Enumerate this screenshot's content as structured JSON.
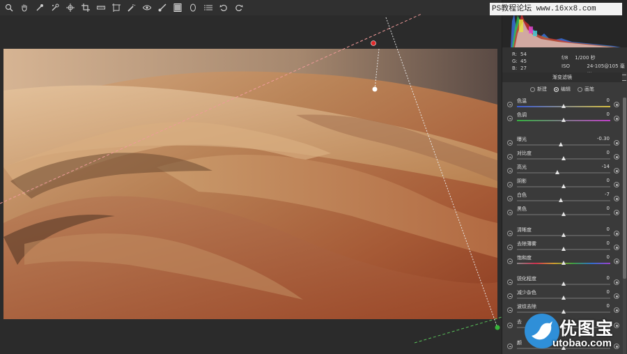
{
  "toolbar": {
    "tools": [
      "zoom-icon",
      "hand-icon",
      "white-balance-icon",
      "color-sampler-icon",
      "target-adjust-icon",
      "crop-icon",
      "straighten-icon",
      "transform-icon",
      "spot-removal-icon",
      "red-eye-icon",
      "adjustment-brush-icon",
      "graduated-filter-icon",
      "radial-filter-icon",
      "presets-list-icon",
      "rotate-left-icon",
      "rotate-right-icon"
    ]
  },
  "watermark_top": "PS教程论坛 www.16xx8.com",
  "info": {
    "r_label": "R:",
    "r": "54",
    "g_label": "G:",
    "g": "45",
    "b_label": "B:",
    "b": "27",
    "aperture": "f/8",
    "shutter": "1/200 秒",
    "iso": "ISO 200",
    "lens": "24-105@105 毫米"
  },
  "panel": {
    "title": "渐变滤镜",
    "modes": [
      {
        "label": "新建",
        "selected": false
      },
      {
        "label": "编辑",
        "selected": true
      },
      {
        "label": "画笔",
        "selected": false
      }
    ],
    "sliders": [
      {
        "label": "色温",
        "value": "0",
        "pos": 0.5
      },
      {
        "label": "色调",
        "value": "0",
        "pos": 0.5
      },
      {
        "label": "曝光",
        "value": "-0.30",
        "pos": 0.47
      },
      {
        "label": "对比度",
        "value": "0",
        "pos": 0.5
      },
      {
        "label": "高光",
        "value": "-14",
        "pos": 0.43
      },
      {
        "label": "阴影",
        "value": "0",
        "pos": 0.5
      },
      {
        "label": "白色",
        "value": "-7",
        "pos": 0.47
      },
      {
        "label": "黑色",
        "value": "0",
        "pos": 0.5
      },
      {
        "label": "清晰度",
        "value": "0",
        "pos": 0.5
      },
      {
        "label": "去除薄雾",
        "value": "0",
        "pos": 0.5
      },
      {
        "label": "饱和度",
        "value": "0",
        "pos": 0.5
      },
      {
        "label": "锐化程度",
        "value": "0",
        "pos": 0.5
      },
      {
        "label": "减少杂色",
        "value": "0",
        "pos": 0.5
      },
      {
        "label": "波纹去除",
        "value": "0",
        "pos": 0.5
      },
      {
        "label": "去",
        "value": "",
        "pos": 0.5
      },
      {
        "label": "颜",
        "value": "",
        "pos": 0.5
      }
    ]
  },
  "logo": {
    "cn": "优图宝",
    "en": "utobao.com"
  }
}
